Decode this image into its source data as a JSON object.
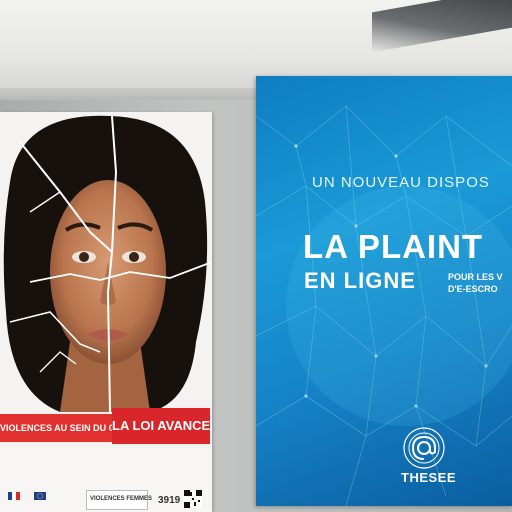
{
  "scene": "posters on wall",
  "left_poster": {
    "banner_left": "VIOLENCES AU SEIN DU COUPLE",
    "banner_right": "LA LOI AVANCE",
    "footer_phone": "3919",
    "footer_org": "VIOLENCES FEMMES"
  },
  "right_poster": {
    "subtitle": "UN NOUVEAU DISPOS",
    "title_line1": "LA PLAINT",
    "title_line2": "EN LIGNE",
    "side_line1": "POUR LES V",
    "side_line2": "D'E-ESCRO",
    "logo_label": "THESEE"
  },
  "colors": {
    "poster_blue": "#1a9ad6",
    "banner_red": "#d8262a",
    "wall_gray": "#b9bbba"
  }
}
